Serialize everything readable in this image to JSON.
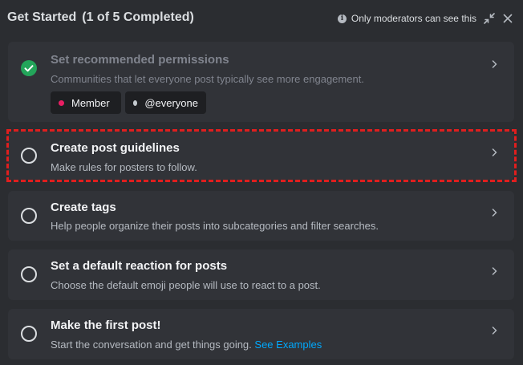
{
  "header": {
    "title": "Get Started",
    "progress": "(1 of 5 Completed)",
    "moderator_note": "Only moderators can see this"
  },
  "tasks": [
    {
      "title": "Set recommended permissions",
      "description": "Communities that let everyone post typically see more engagement.",
      "completed": true
    },
    {
      "title": "Create post guidelines",
      "description": "Make rules for posters to follow.",
      "completed": false
    },
    {
      "title": "Create tags",
      "description": "Help people organize their posts into subcategories and filter searches.",
      "completed": false
    },
    {
      "title": "Set a default reaction for posts",
      "description": "Choose the default emoji people will use to react to a post.",
      "completed": false
    },
    {
      "title": "Make the first post!",
      "description": "Start the conversation and get things going.",
      "link": "See Examples",
      "completed": false
    }
  ],
  "roles": [
    {
      "name": "Member",
      "color": "#e91e63"
    },
    {
      "name": "@everyone",
      "color": "#c4c9ce"
    }
  ],
  "colors": {
    "background": "#2b2d31",
    "card": "#313338",
    "success": "#23a55a",
    "link": "#00a8fc",
    "highlight": "#e01e1e"
  }
}
